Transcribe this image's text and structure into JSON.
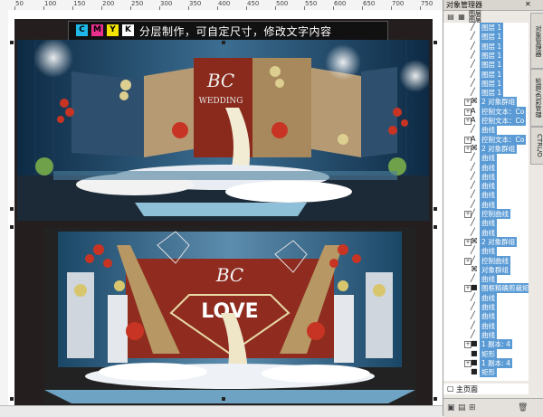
{
  "banner": {
    "cmyk": [
      "C",
      "M",
      "Y",
      "K"
    ],
    "cmyk_colors": [
      "#20b8e8",
      "#e8308f",
      "#f5e400",
      "#111111"
    ],
    "text": "分层制作，可自定尺寸，修改文字内容"
  },
  "ruler": {
    "labels": [
      "50",
      "100",
      "150",
      "200",
      "250",
      "300",
      "350",
      "400",
      "450",
      "500",
      "550",
      "600",
      "650",
      "700",
      "750"
    ]
  },
  "stage_top": {
    "monogram": "BC",
    "wedding_text": "WEDDING"
  },
  "stage_bottom": {
    "monogram": "BC",
    "love_text": "LOVE"
  },
  "panel": {
    "title": "对象管理器",
    "top_items": [
      "图层",
      "图层"
    ],
    "tabs": [
      "对象管理器",
      "轮廓/色彩管理",
      "CTRL/O"
    ],
    "root_label": "主页面",
    "rows": [
      {
        "label": "图层 1",
        "selected": true,
        "icon": "curve",
        "expand": ""
      },
      {
        "label": "图层 1",
        "selected": true,
        "icon": "curve",
        "expand": ""
      },
      {
        "label": "图层 1",
        "selected": true,
        "icon": "curve",
        "expand": ""
      },
      {
        "label": "图层 1",
        "selected": true,
        "icon": "curve",
        "expand": ""
      },
      {
        "label": "图层 1",
        "selected": true,
        "icon": "curve",
        "expand": ""
      },
      {
        "label": "图层 1",
        "selected": true,
        "icon": "curve",
        "expand": ""
      },
      {
        "label": "图层 1",
        "selected": true,
        "icon": "curve",
        "expand": ""
      },
      {
        "label": "图层 1",
        "selected": true,
        "icon": "curve",
        "expand": ""
      },
      {
        "label": "2 对象群组",
        "selected": true,
        "icon": "group",
        "expand": "+"
      },
      {
        "label": "控制文本：Co",
        "selected": true,
        "icon": "text",
        "expand": "+"
      },
      {
        "label": "控制文本：Co",
        "selected": true,
        "icon": "text",
        "expand": "+"
      },
      {
        "label": "曲线",
        "selected": true,
        "icon": "curve",
        "expand": ""
      },
      {
        "label": "控制文本：Co",
        "selected": true,
        "icon": "text",
        "expand": "+"
      },
      {
        "label": "2 对象群组",
        "selected": true,
        "icon": "group",
        "expand": "+"
      },
      {
        "label": "曲线",
        "selected": true,
        "icon": "curve",
        "expand": ""
      },
      {
        "label": "曲线",
        "selected": true,
        "icon": "curve",
        "expand": ""
      },
      {
        "label": "曲线",
        "selected": true,
        "icon": "curve",
        "expand": ""
      },
      {
        "label": "曲线",
        "selected": true,
        "icon": "curve",
        "expand": ""
      },
      {
        "label": "曲线",
        "selected": true,
        "icon": "curve",
        "expand": ""
      },
      {
        "label": "曲线",
        "selected": true,
        "icon": "curve",
        "expand": ""
      },
      {
        "label": "控制曲线",
        "selected": true,
        "icon": "curve",
        "expand": "+"
      },
      {
        "label": "曲线",
        "selected": true,
        "icon": "curve",
        "expand": ""
      },
      {
        "label": "曲线",
        "selected": true,
        "icon": "curve",
        "expand": ""
      },
      {
        "label": "2 对象群组",
        "selected": true,
        "icon": "group",
        "expand": "+"
      },
      {
        "label": "曲线",
        "selected": true,
        "icon": "curve",
        "expand": ""
      },
      {
        "label": "控制曲线",
        "selected": true,
        "icon": "curve",
        "expand": "+"
      },
      {
        "label": "对象群组",
        "selected": true,
        "icon": "group",
        "expand": ""
      },
      {
        "label": "曲线",
        "selected": true,
        "icon": "curve",
        "expand": ""
      },
      {
        "label": "图框精确剪裁矩",
        "selected": true,
        "icon": "rect",
        "expand": "+"
      },
      {
        "label": "曲线",
        "selected": true,
        "icon": "curve",
        "expand": ""
      },
      {
        "label": "曲线",
        "selected": true,
        "icon": "curve",
        "expand": ""
      },
      {
        "label": "曲线",
        "selected": true,
        "icon": "curve",
        "expand": ""
      },
      {
        "label": "曲线",
        "selected": true,
        "icon": "curve",
        "expand": ""
      },
      {
        "label": "曲线",
        "selected": true,
        "icon": "curve",
        "expand": ""
      },
      {
        "label": "1 副本: 4",
        "selected": true,
        "icon": "rect",
        "expand": "+"
      },
      {
        "label": "矩形",
        "selected": true,
        "icon": "rect",
        "expand": ""
      },
      {
        "label": "1 副本: 4",
        "selected": true,
        "icon": "rect",
        "expand": "+"
      },
      {
        "label": "矩形",
        "selected": true,
        "icon": "rect",
        "expand": ""
      }
    ]
  }
}
